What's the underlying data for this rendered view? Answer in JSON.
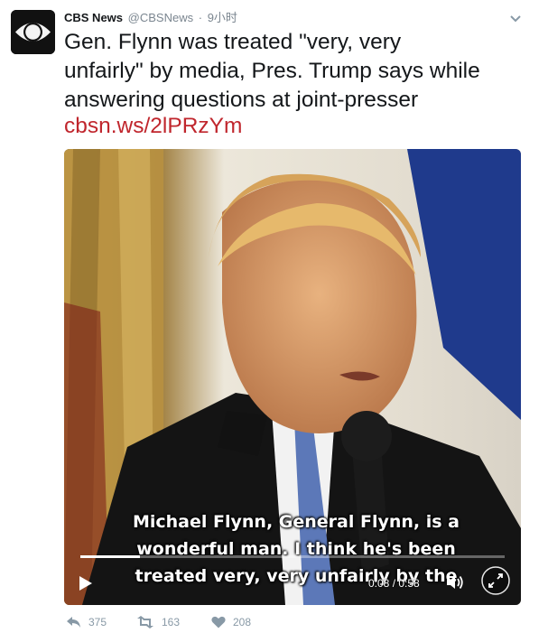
{
  "tweet": {
    "author_name": "CBS News",
    "author_handle": "@CBSNews",
    "separator": "·",
    "timestamp": "9小时",
    "avatar_icon": "cbs-eye-logo",
    "text_lines": [
      "Gen. Flynn was treated \"very, very",
      "unfairly\" by media, Pres. Trump says while",
      "answering questions at joint-presser"
    ],
    "link_text": "cbsn.ws/2lPRzYm",
    "link_color": "#c0262d"
  },
  "video": {
    "caption_lines": [
      "Michael Flynn, General Flynn, is a",
      "wonderful man. I think he's been",
      "treated very, very unfairly by the"
    ],
    "timecode": "0:08 / 0:58",
    "progress_fraction": 0.14,
    "play_icon": "play-icon",
    "volume_icon": "volume-icon",
    "fullscreen_icon": "fullscreen-icon"
  },
  "actions": {
    "reply_count": "375",
    "retweet_count": "163",
    "like_count": "208",
    "reply_icon": "reply-icon",
    "retweet_icon": "retweet-icon",
    "like_icon": "heart-icon"
  },
  "colors": {
    "name": "#14171a",
    "muted": "#7b8690",
    "action": "#8899a6"
  }
}
